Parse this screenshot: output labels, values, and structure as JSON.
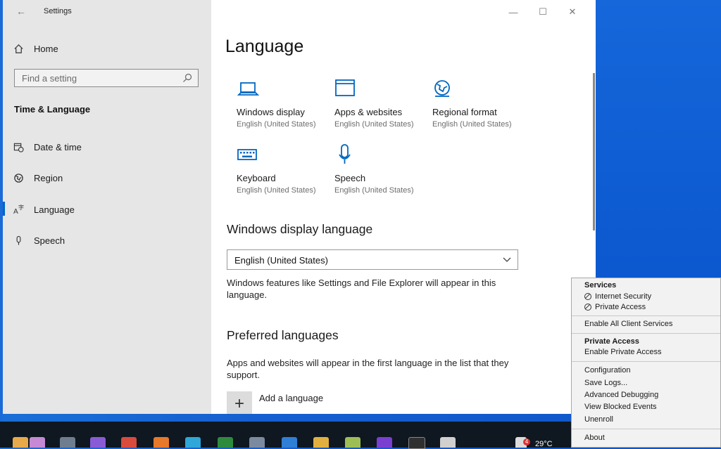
{
  "window": {
    "title": "Settings",
    "controls": {
      "minimize": "—",
      "maximize": "☐",
      "close": "✕"
    }
  },
  "sidebar": {
    "home": "Home",
    "search_placeholder": "Find a setting",
    "section": "Time & Language",
    "items": [
      {
        "label": "Date & time",
        "icon": "calendar-clock-icon"
      },
      {
        "label": "Region",
        "icon": "globe-icon"
      },
      {
        "label": "Language",
        "icon": "language-icon",
        "active": true
      },
      {
        "label": "Speech",
        "icon": "microphone-icon"
      }
    ]
  },
  "main": {
    "title": "Language",
    "tiles": [
      {
        "name": "Windows display",
        "sub": "English (United States)",
        "icon": "laptop-icon"
      },
      {
        "name": "Apps & websites",
        "sub": "English (United States)",
        "icon": "window-icon"
      },
      {
        "name": "Regional format",
        "sub": "English (United States)",
        "icon": "globe-icon"
      },
      {
        "name": "Keyboard",
        "sub": "English (United States)",
        "icon": "keyboard-icon"
      },
      {
        "name": "Speech",
        "sub": "English (United States)",
        "icon": "microphone-icon"
      }
    ],
    "display_language_heading": "Windows display language",
    "display_language_value": "English (United States)",
    "display_language_desc": "Windows features like Settings and File Explorer will appear in this language.",
    "preferred_heading": "Preferred languages",
    "preferred_desc": "Apps and websites will appear in the first language in the list that they support.",
    "add_language": "Add a language"
  },
  "context_menu": {
    "services_header": "Services",
    "services": [
      "Internet Security",
      "Private Access"
    ],
    "enable_all": "Enable All Client Services",
    "private_access_header": "Private Access",
    "enable_private_access": "Enable Private Access",
    "items": [
      "Configuration",
      "Save Logs...",
      "Advanced Debugging",
      "View Blocked Events",
      "Unenroll"
    ],
    "about": "About"
  },
  "taskbar": {
    "temperature": "29°C",
    "notification_count": "4"
  },
  "colors": {
    "accent": "#0067c0",
    "sidebar": "#e6e6e6",
    "desktop": "#1565d8",
    "taskbar": "#0f1720"
  }
}
